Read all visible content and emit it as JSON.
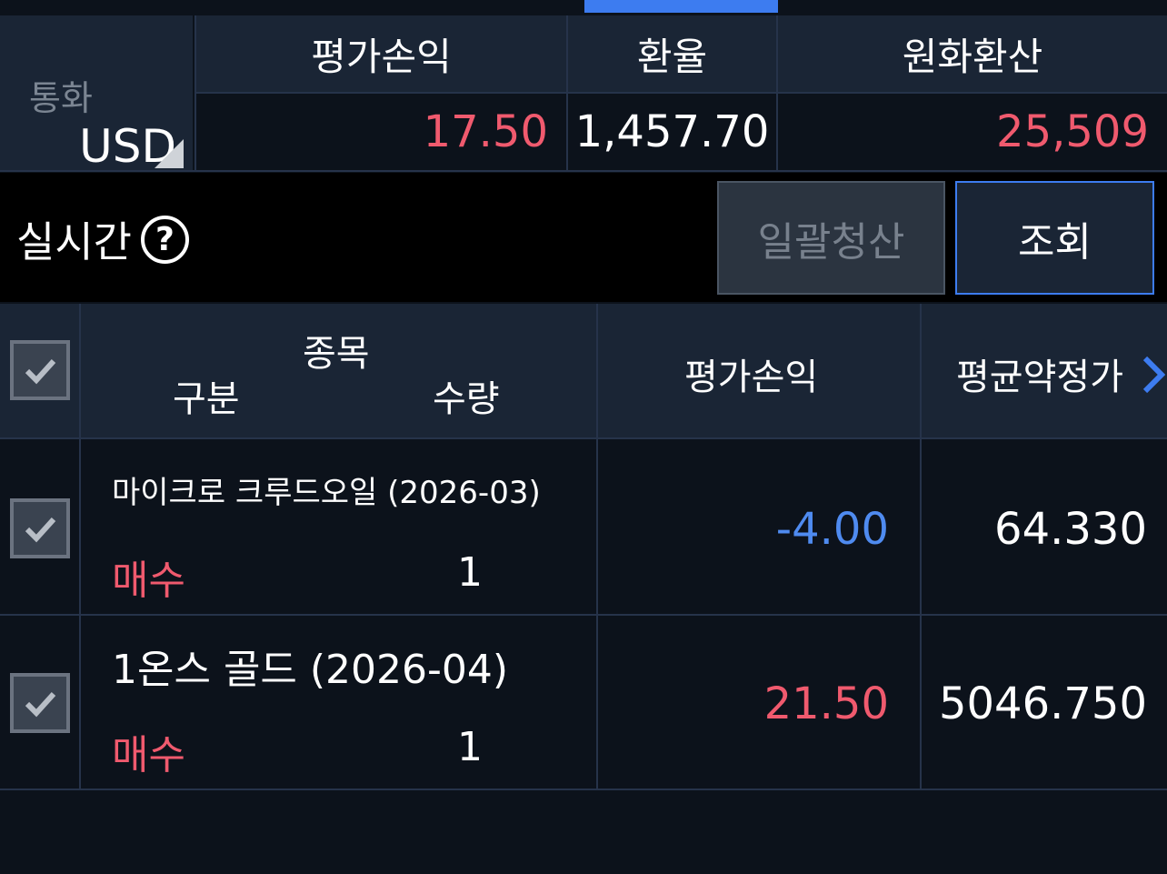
{
  "summary": {
    "currency_label": "통화",
    "currency_value": "USD",
    "headers": [
      "평가손익",
      "환율",
      "원화환산"
    ],
    "pl_value": "17.50",
    "fx_rate": "1,457.70",
    "krw_value": "25,509"
  },
  "realtime": {
    "label": "실시간",
    "help_glyph": "?",
    "liquidate_all_label": "일괄청산",
    "query_label": "조회"
  },
  "table": {
    "headers": {
      "item": "종목",
      "side": "구분",
      "qty": "수량",
      "pl": "평가손익",
      "avg_price": "평균약정가"
    },
    "rows": [
      {
        "name": "마이크로 크루드오일 (2026-03)",
        "side": "매수",
        "qty": "1",
        "pl": "-4.00",
        "avg_price": "64.330"
      },
      {
        "name": "1온스 골드 (2026-04)",
        "side": "매수",
        "qty": "1",
        "pl": "21.50",
        "avg_price": "5046.750"
      }
    ]
  },
  "colors": {
    "accent_blue": "#3d7cf0",
    "profit_red": "#f05a6e",
    "loss_blue": "#4f8bf0",
    "panel_bg": "#1a2535",
    "page_bg": "#0c121b"
  }
}
